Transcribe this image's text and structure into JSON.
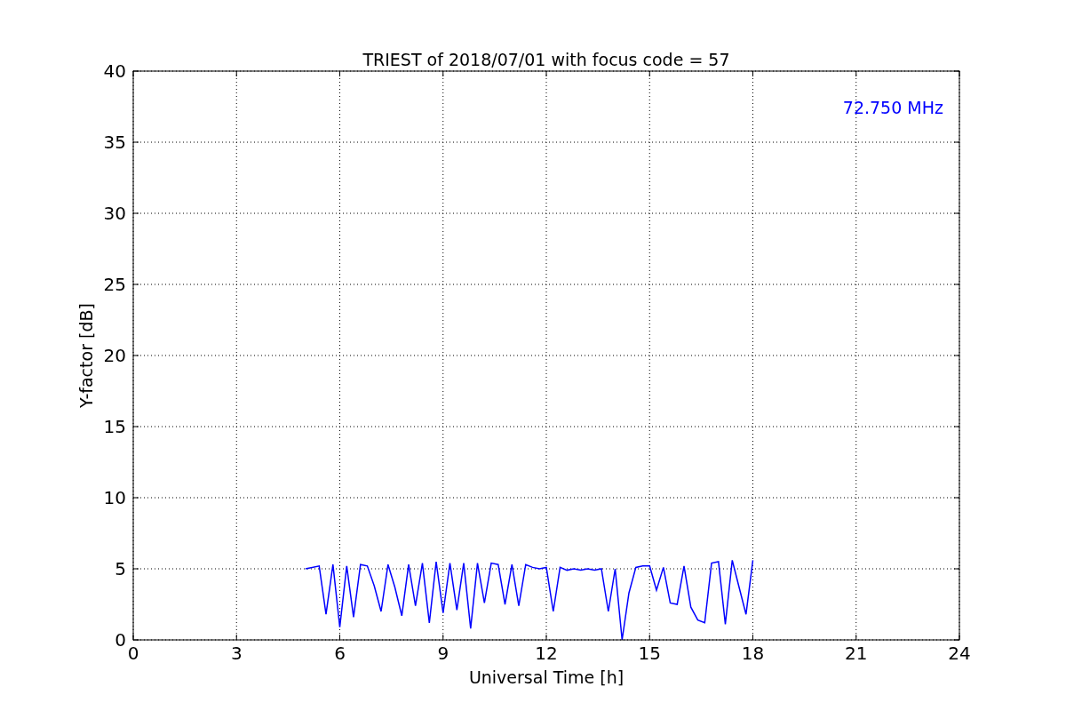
{
  "figure": {
    "chart_data": {
      "type": "line",
      "title": "TRIEST of 2018/07/01 with focus code = 57",
      "xlabel": "Universal Time [h]",
      "ylabel": "Y-factor [dB]",
      "x": [
        5.0,
        5.2,
        5.4,
        5.6,
        5.8,
        6.0,
        6.2,
        6.4,
        6.6,
        6.8,
        7.0,
        7.2,
        7.4,
        7.6,
        7.8,
        8.0,
        8.2,
        8.4,
        8.6,
        8.8,
        9.0,
        9.2,
        9.4,
        9.6,
        9.8,
        10.0,
        10.2,
        10.4,
        10.6,
        10.8,
        11.0,
        11.2,
        11.4,
        11.6,
        11.8,
        12.0,
        12.2,
        12.4,
        12.6,
        12.8,
        13.0,
        13.2,
        13.4,
        13.6,
        13.8,
        14.0,
        14.2,
        14.4,
        14.6,
        14.8,
        15.0,
        15.2,
        15.4,
        15.6,
        15.8,
        16.0,
        16.2,
        16.4,
        16.6,
        16.8,
        17.0,
        17.2,
        17.4,
        17.6,
        17.8,
        18.0
      ],
      "series": [
        {
          "name": "72.750 MHz",
          "color": "#0000ff",
          "values": [
            5.0,
            5.1,
            5.2,
            1.8,
            5.3,
            0.9,
            5.2,
            1.6,
            5.3,
            5.2,
            3.8,
            2.0,
            5.3,
            3.7,
            1.7,
            5.3,
            2.4,
            5.4,
            1.2,
            5.5,
            1.9,
            5.4,
            2.1,
            5.4,
            0.8,
            5.4,
            2.6,
            5.4,
            5.3,
            2.5,
            5.3,
            2.4,
            5.3,
            5.1,
            5.0,
            5.1,
            2.0,
            5.1,
            4.9,
            5.0,
            4.9,
            5.0,
            4.9,
            5.0,
            2.0,
            5.0,
            0.0,
            3.3,
            5.1,
            5.2,
            5.2,
            3.5,
            5.1,
            2.6,
            2.5,
            5.2,
            2.3,
            1.4,
            1.2,
            5.4,
            5.5,
            1.1,
            5.6,
            3.7,
            1.8,
            5.6
          ]
        }
      ],
      "xlim": [
        0,
        24
      ],
      "ylim": [
        0,
        40
      ],
      "xticks": [
        0,
        3,
        6,
        9,
        12,
        15,
        18,
        21,
        24
      ],
      "yticks": [
        0,
        5,
        10,
        15,
        20,
        25,
        30,
        35,
        40
      ],
      "grid": true
    }
  }
}
